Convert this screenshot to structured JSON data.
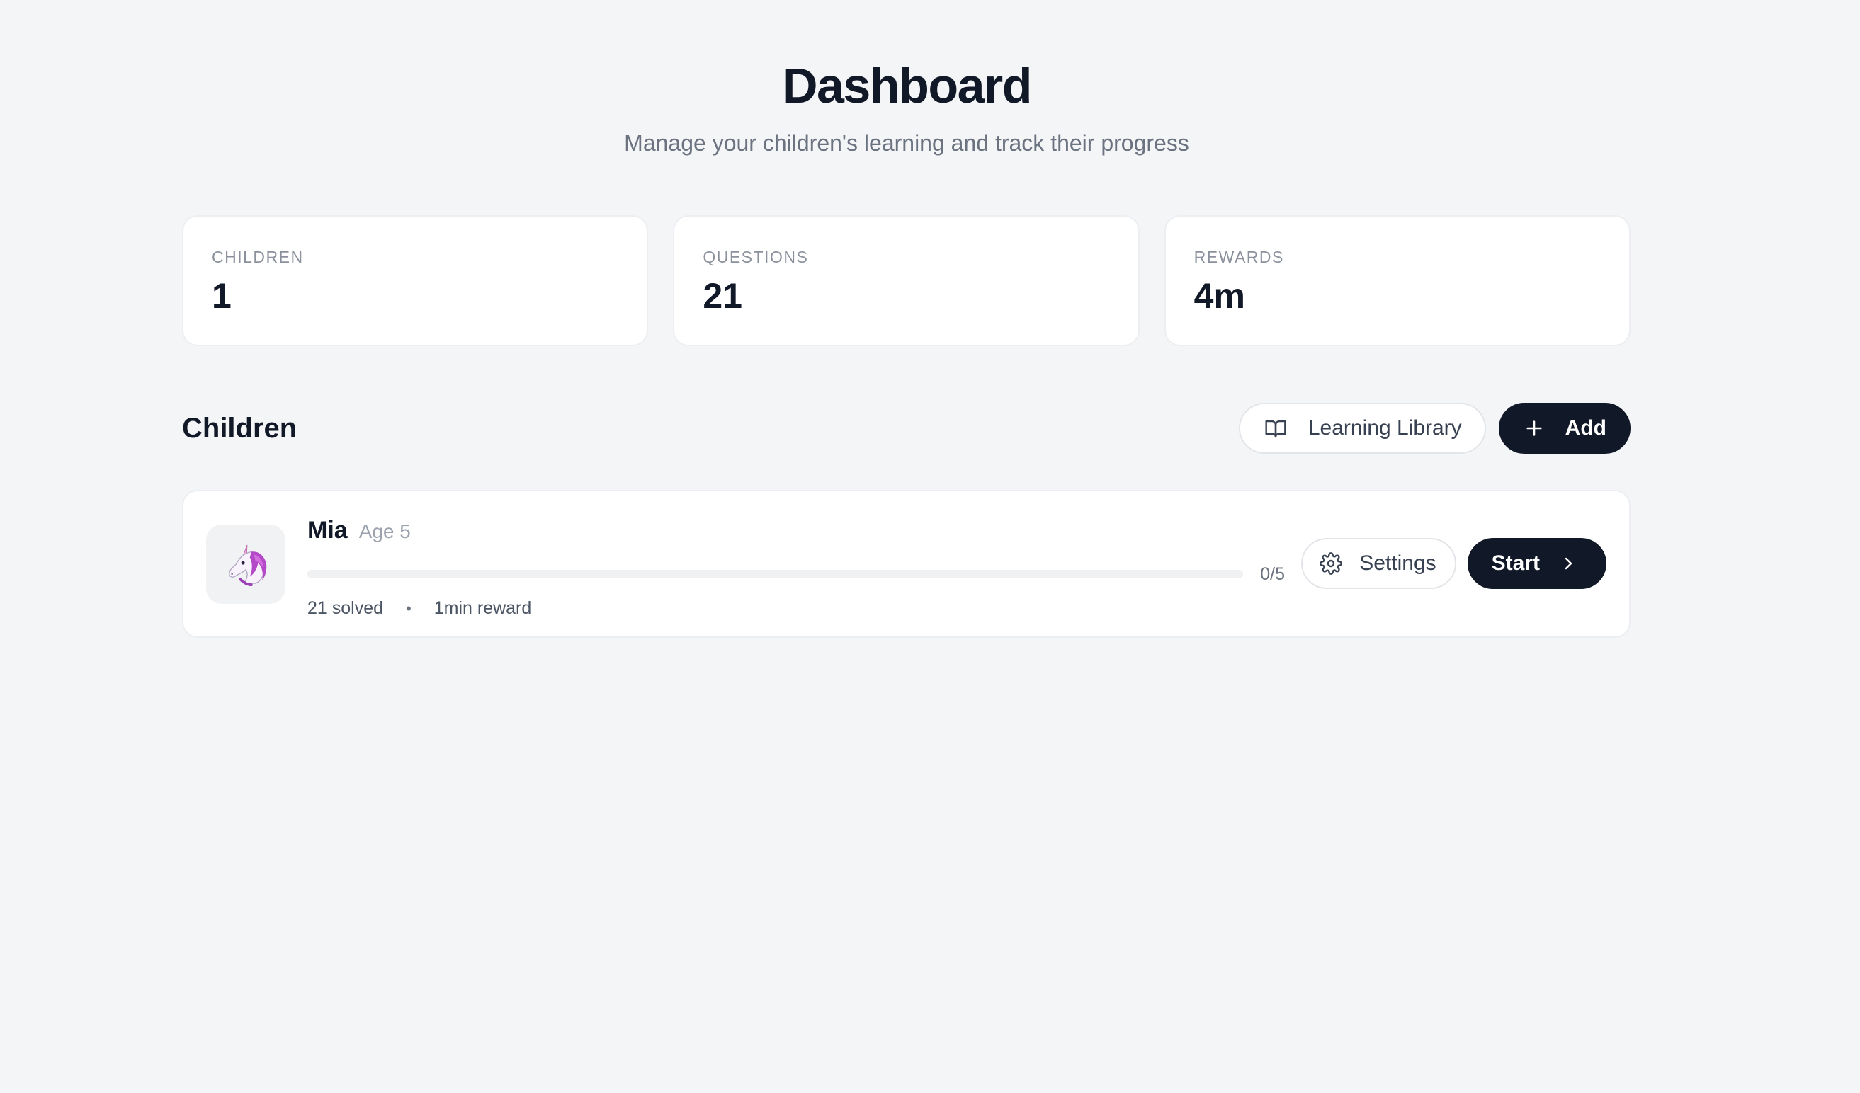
{
  "header": {
    "title": "Dashboard",
    "subtitle": "Manage your children's learning and track their progress"
  },
  "stats": [
    {
      "label": "CHILDREN",
      "value": "1"
    },
    {
      "label": "QUESTIONS",
      "value": "21"
    },
    {
      "label": "REWARDS",
      "value": "4m"
    }
  ],
  "children_section": {
    "title": "Children",
    "library_label": "Learning Library",
    "library_icon": "book-open-icon",
    "add_label": "Add",
    "add_icon": "plus-icon"
  },
  "children": [
    {
      "avatar": "🦄",
      "avatar_icon": "unicorn-icon",
      "name": "Mia",
      "age": "Age 5",
      "progress_text": "0/5",
      "progress_fraction": 0,
      "solved": "21 solved",
      "separator": "•",
      "reward": "1min reward",
      "settings_label": "Settings",
      "settings_icon": "gear-icon",
      "start_label": "Start",
      "start_icon": "chevron-right-icon"
    }
  ],
  "colors": {
    "background": "#f4f5f7",
    "card": "#ffffff",
    "primary_dark": "#111827",
    "muted_text": "#6b7280"
  }
}
